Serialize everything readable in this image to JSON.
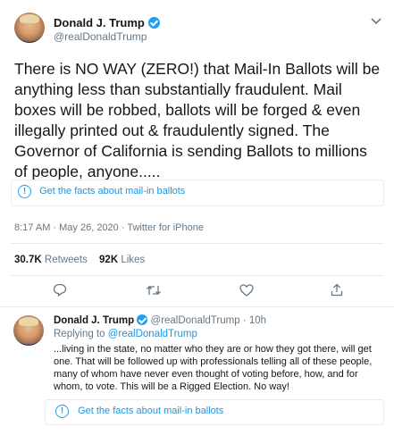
{
  "tweet": {
    "author_name": "Donald J. Trump",
    "author_handle": "@realDonaldTrump",
    "text": "There is NO WAY (ZERO!) that Mail-In Ballots will be anything less than substantially fraudulent. Mail boxes will be robbed, ballots will be forged & even illegally printed out & fraudulently signed. The Governor of California is sending Ballots to millions of people, anyone.....",
    "fact_check_label": "Get the facts about mail-in ballots",
    "timestamp": "8:17 AM · May 26, 2020 · Twitter for iPhone",
    "retweets_count": "30.7K",
    "retweets_label": "Retweets",
    "likes_count": "92K",
    "likes_label": "Likes",
    "more_icon": "chevron-down-icon"
  },
  "reply": {
    "author_name": "Donald J. Trump",
    "author_handle": "@realDonaldTrump",
    "time": "· 10h",
    "replying_prefix": "Replying to",
    "replying_to": "@realDonaldTrump",
    "text": "...living in the state, no matter who they are or how they got there, will get one. That will be followed up with professionals telling all of these people, many of whom have never even thought of voting before, how, and for whom, to vote. This will be a Rigged Election. No way!",
    "fact_check_label": "Get the facts about mail-in ballots"
  },
  "colors": {
    "accent": "#1da1f2",
    "link": "#1b95e0",
    "muted": "#657786",
    "divider": "#e6ecf0"
  }
}
